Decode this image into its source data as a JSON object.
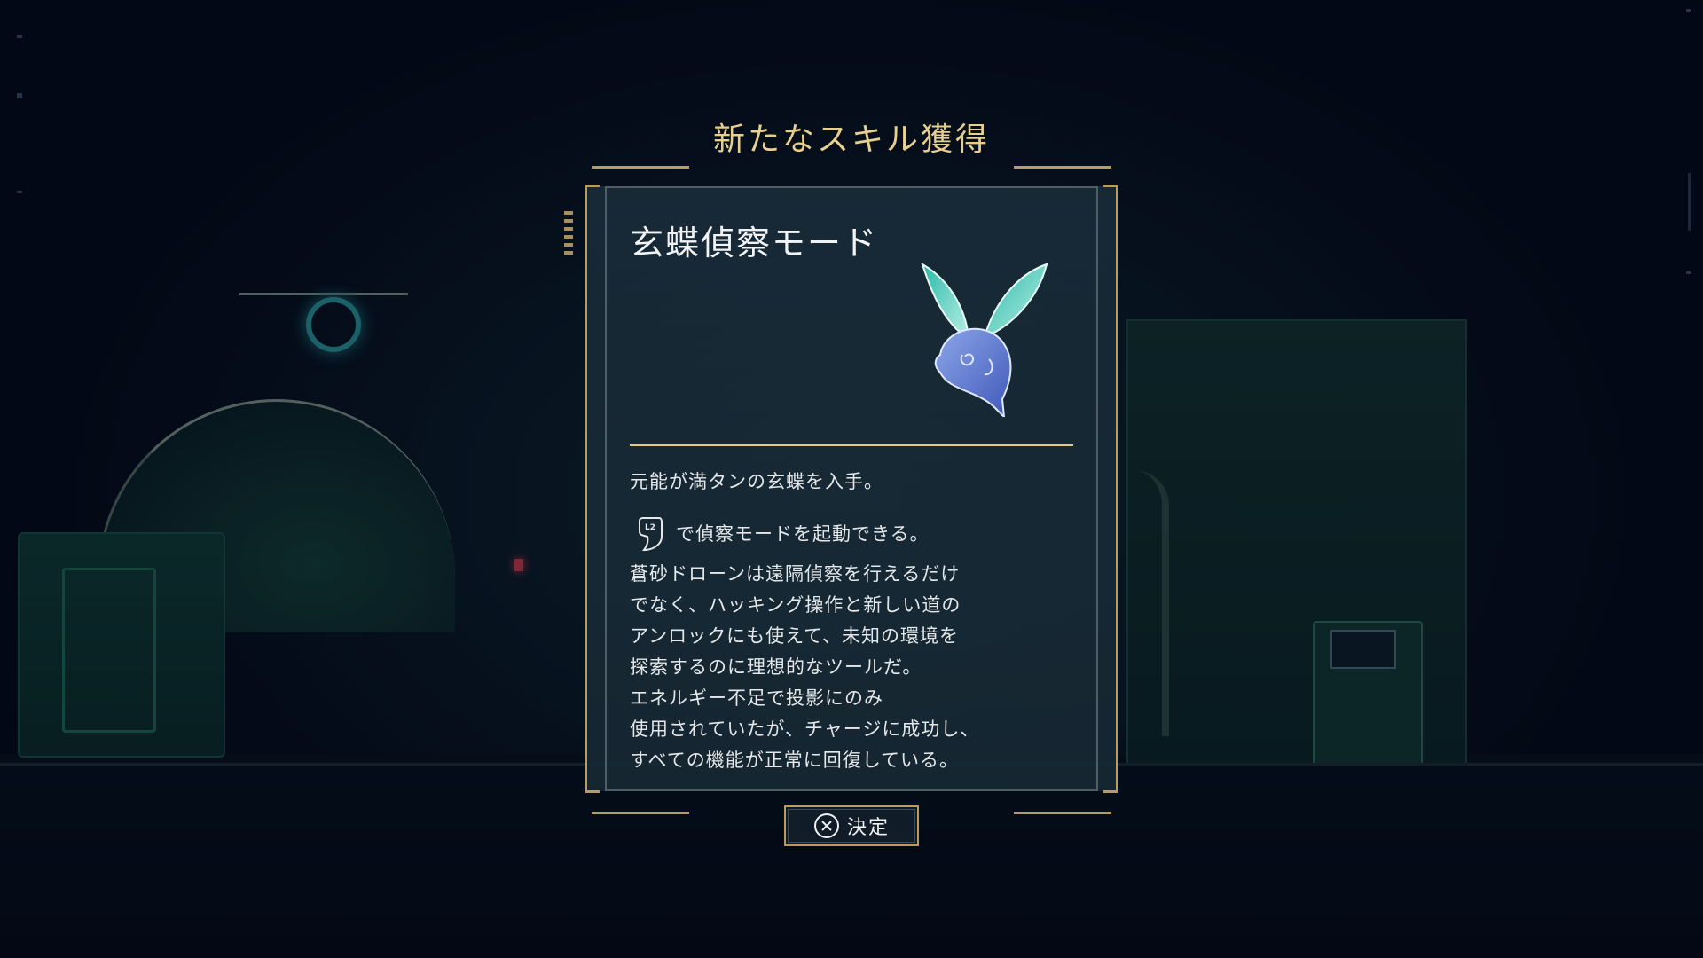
{
  "dialog": {
    "header": "新たなスキル獲得",
    "skill_name": "玄蝶偵察モード",
    "skill_icon": "butterfly-drone-icon",
    "description": {
      "line1": "元能が満タンの玄蝶を入手。",
      "button_hint_icon": "l2-trigger-icon",
      "button_hint_icon_label": "L2",
      "line2": "で偵察モードを起動できる。",
      "paragraph": [
        "蒼砂ドローンは遠隔偵察を行えるだけ",
        "でなく、ハッキング操作と新しい道の",
        "アンロックにも使えて、未知の環境を",
        "探索するのに理想的なツールだ。",
        "エネルギー不足で投影にのみ",
        "使用されていたが、チャージに成功し、",
        "すべての機能が正常に回復している。"
      ]
    },
    "confirm": {
      "icon": "cross-button-icon",
      "label": "決定"
    }
  },
  "colors": {
    "accent_gold": "#b79d5f",
    "title_gold": "#e7cf8e",
    "card_bg": "#192b38",
    "text": "#e5e8ea"
  }
}
